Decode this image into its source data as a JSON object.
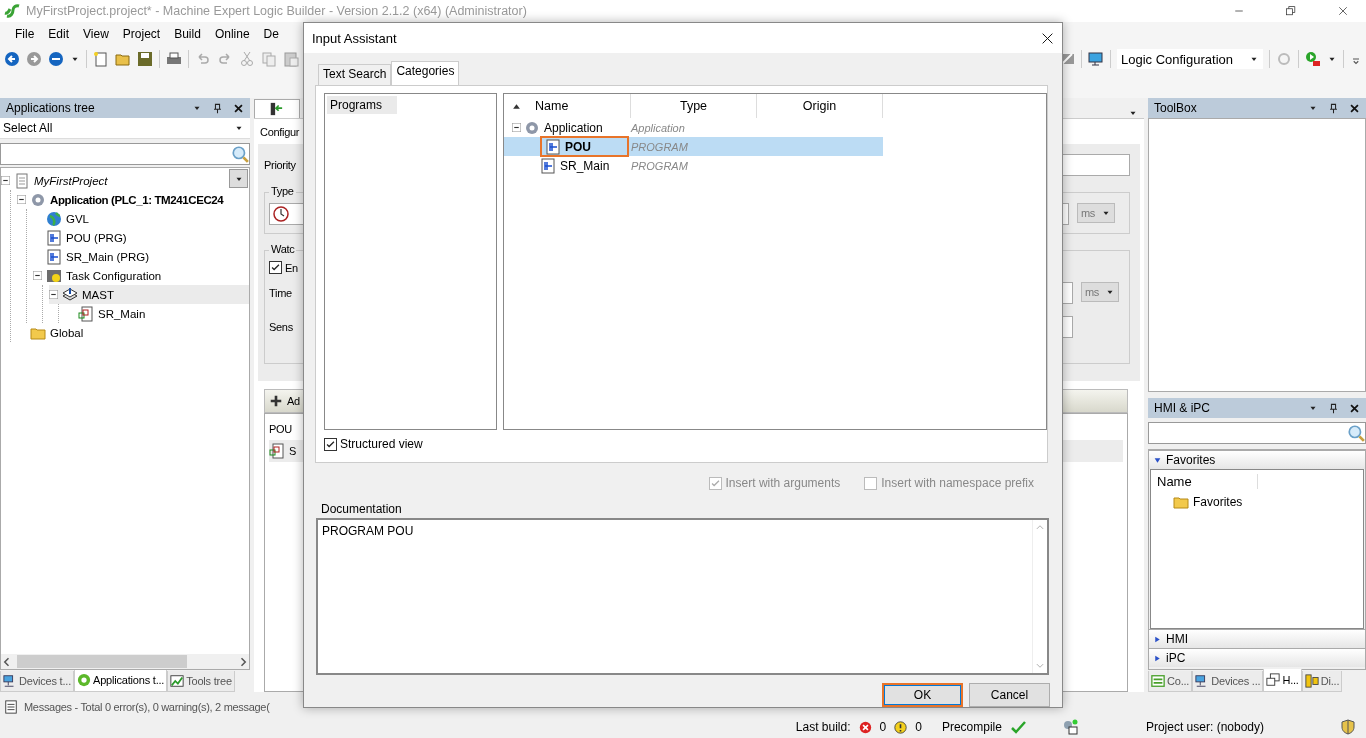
{
  "window": {
    "title": "MyFirstProject.project* - Machine Expert Logic Builder - Version 2.1.2 (x64) (Administrator)"
  },
  "menu": [
    "File",
    "Edit",
    "View",
    "Project",
    "Build",
    "Online",
    "De"
  ],
  "toolbar": {
    "configuration": "Logic Configuration"
  },
  "applications_tree": {
    "title": "Applications tree",
    "filter": "Select All",
    "items": [
      {
        "label": "MyFirstProject",
        "kind": "project",
        "expanded": true,
        "selected": false,
        "children": [
          {
            "label": "Application (PLC_1: TM241CEC24",
            "kind": "application",
            "expanded": true,
            "selected": false,
            "children": [
              {
                "label": "GVL",
                "kind": "gvl",
                "selected": false
              },
              {
                "label": "POU (PRG)",
                "kind": "pou",
                "selected": false
              },
              {
                "label": "SR_Main (PRG)",
                "kind": "pou",
                "selected": false
              },
              {
                "label": "Task Configuration",
                "kind": "tasks",
                "expanded": true,
                "selected": false,
                "children": [
                  {
                    "label": "MAST",
                    "kind": "task",
                    "expanded": true,
                    "selected": true,
                    "children": [
                      {
                        "label": "SR_Main",
                        "kind": "call",
                        "selected": false
                      }
                    ]
                  }
                ]
              }
            ]
          },
          {
            "label": "Global",
            "kind": "folder",
            "selected": false
          }
        ]
      }
    ]
  },
  "left_tabs": [
    {
      "label": "Devices t...",
      "kind": "devices",
      "selected": false
    },
    {
      "label": "Applications t...",
      "kind": "applications",
      "selected": true
    },
    {
      "label": "Tools tree",
      "kind": "tools",
      "selected": false
    }
  ],
  "task_editor": {
    "section": "Configur",
    "priority_label": "Priority",
    "type_group": "Type",
    "watchdog_group": "Watc",
    "enable": {
      "label": "En",
      "checked": true
    },
    "time_label": "Time",
    "sensitivity_label": "Sens",
    "type_unit": "ms",
    "time_unit": "ms",
    "add_button": "Ad",
    "pou_column": "POU",
    "pou_rows": [
      "S"
    ]
  },
  "toolbox": {
    "title": "ToolBox"
  },
  "hmi_panel": {
    "title": "HMI & iPC",
    "sections": [
      {
        "label": "Favorites",
        "expanded": true,
        "column": "Name",
        "items": [
          "Favorites"
        ]
      },
      {
        "label": "HMI",
        "expanded": false
      },
      {
        "label": "iPC",
        "expanded": false
      }
    ]
  },
  "right_tabs": [
    {
      "label": "Co...",
      "kind": "config",
      "selected": false
    },
    {
      "label": "Devices ...",
      "kind": "devices",
      "selected": false
    },
    {
      "label": "H...",
      "kind": "hmi",
      "selected": true
    },
    {
      "label": "Di...",
      "kind": "diagram",
      "selected": false
    }
  ],
  "dialog": {
    "title": "Input Assistant",
    "tabs": [
      {
        "label": "Text Search",
        "selected": false
      },
      {
        "label": "Categories",
        "selected": true
      }
    ],
    "categories": [
      {
        "label": "Programs",
        "selected": true
      }
    ],
    "columns": [
      "Name",
      "Type",
      "Origin"
    ],
    "tree": [
      {
        "name": "Application",
        "type": "Application",
        "kind": "application",
        "expanded": true,
        "selected": false,
        "children": [
          {
            "name": "POU",
            "type": "PROGRAM",
            "kind": "pou",
            "selected": true
          },
          {
            "name": "SR_Main",
            "type": "PROGRAM",
            "kind": "pou",
            "selected": false
          }
        ]
      }
    ],
    "structured_view": {
      "label": "Structured view",
      "checked": true
    },
    "options": [
      {
        "label": "Insert with arguments",
        "checked": true,
        "disabled": true
      },
      {
        "label": "Insert with namespace prefix",
        "checked": false,
        "disabled": true
      }
    ],
    "documentation": {
      "label": "Documentation",
      "text": "PROGRAM POU"
    },
    "buttons": [
      {
        "label": "OK",
        "focused": true
      },
      {
        "label": "Cancel",
        "focused": false
      }
    ]
  },
  "status": {
    "messages": "Messages - Total 0 error(s), 0 warning(s), 2 message(",
    "last_build": "Last build:",
    "errors": "0",
    "warnings": "0",
    "precompile": "Precompile",
    "project_user": "Project user: (nobody)"
  }
}
